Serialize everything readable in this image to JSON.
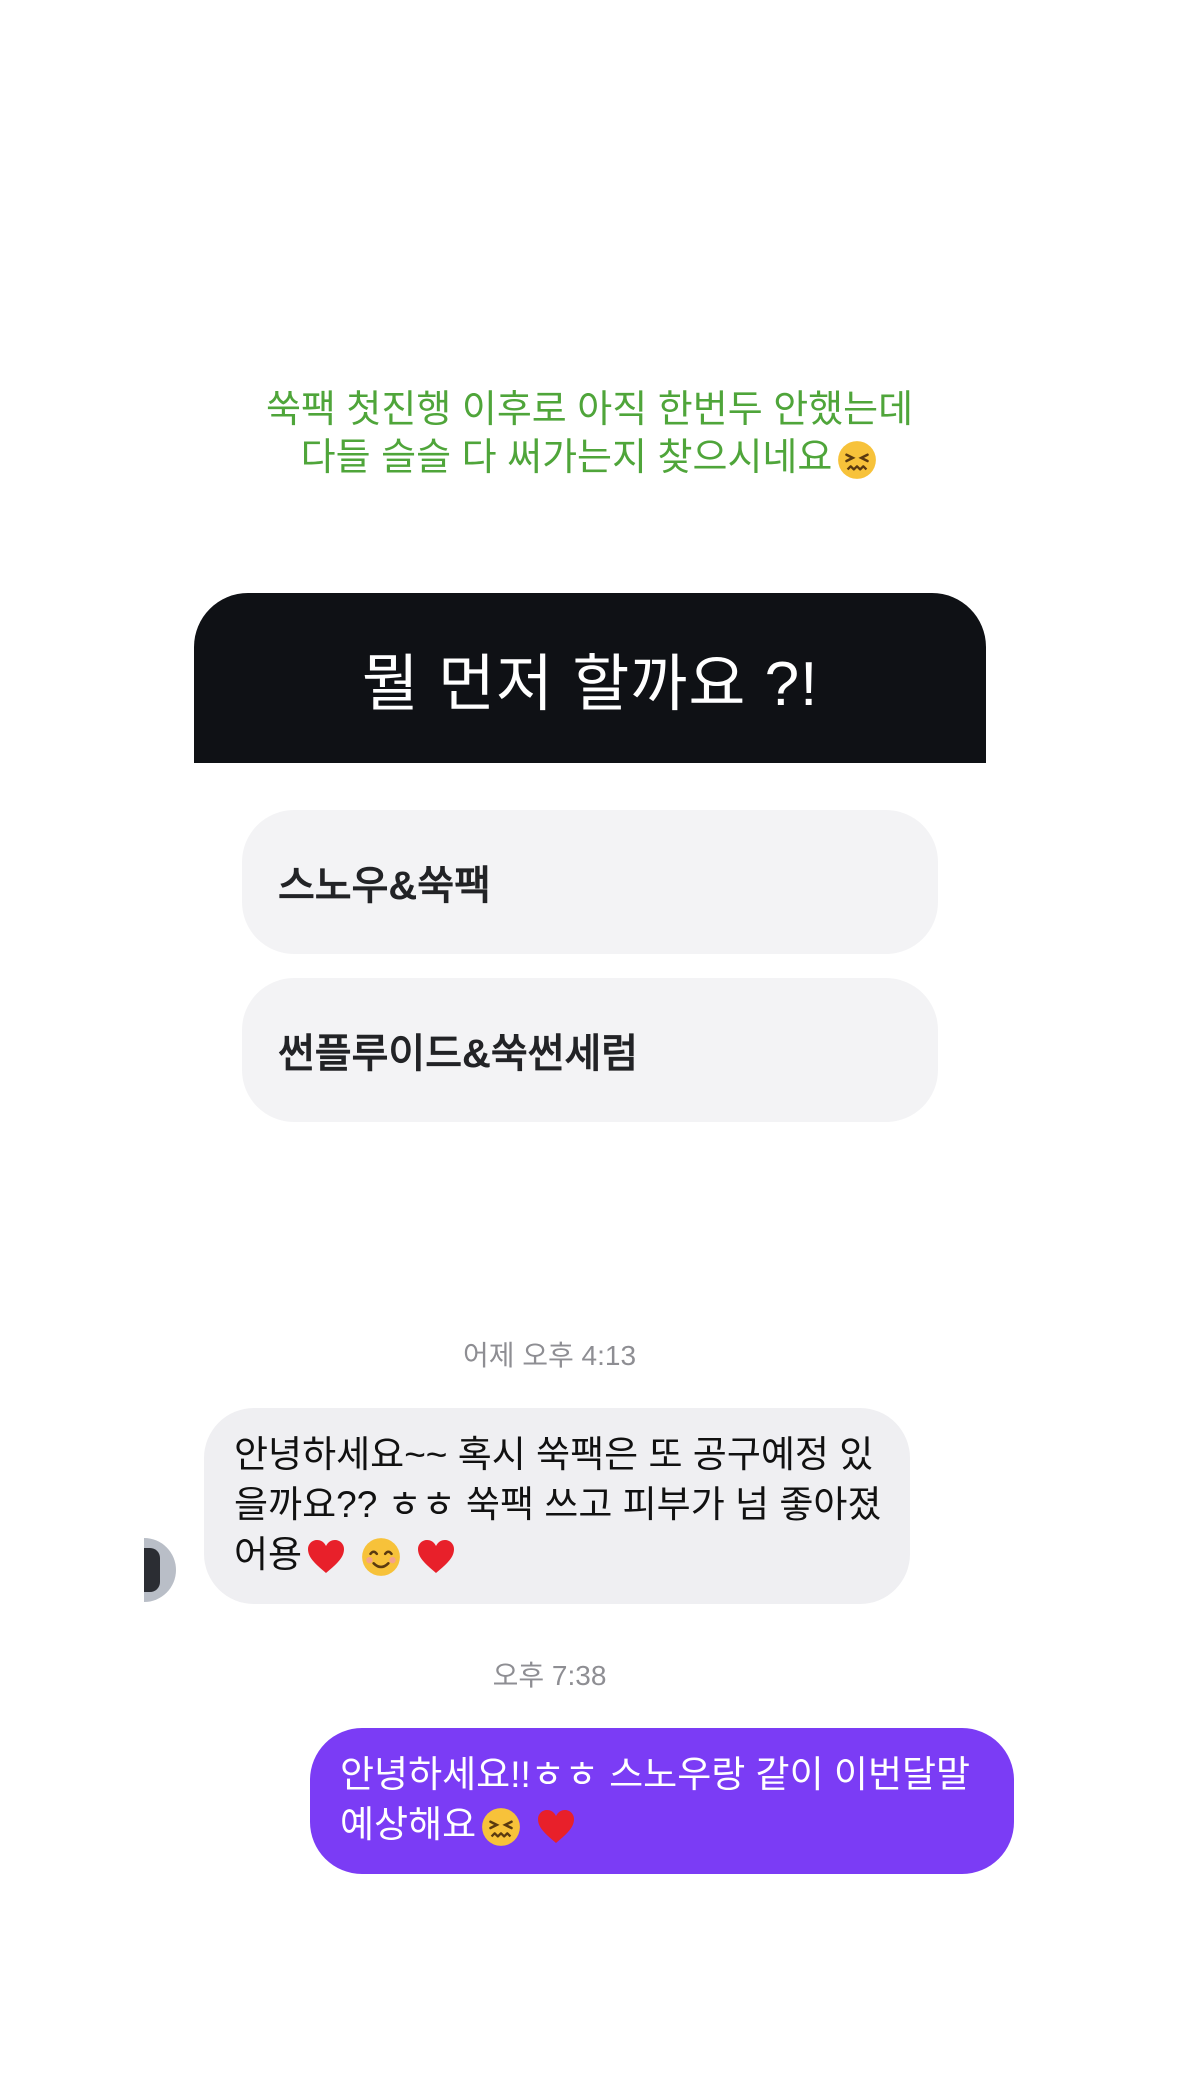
{
  "story": {
    "caption_lines": [
      "쑥팩 첫진행 이후로 아직 한번두 안했는데",
      "다들 슬슬 다 써가는지 찾으시네요"
    ],
    "caption_color": "#4fa53a",
    "caption_emoji": "confounded-face-icon"
  },
  "poll": {
    "question": "뭘 먼저 할까요 ?!",
    "options": [
      "스노우&쑥팩",
      "썬플루이드&쑥썬세럼"
    ]
  },
  "messages": [
    {
      "timestamp": "어제 오후 4:13",
      "direction": "incoming",
      "lines": [
        "안녕하세요~~ 혹시 쑥팩은 또 공구예정 있",
        "을까요?? ㅎㅎ 쑥팩 쓰고 피부가 넘 좋아졌",
        "어용"
      ],
      "emojis": [
        "heart-icon",
        "smiling-face-icon",
        "heart-icon"
      ]
    },
    {
      "timestamp": "오후 7:38",
      "direction": "outgoing",
      "lines": [
        "안녕하세요!!ㅎㅎ 스노우랑 같이 이번달말",
        "예상해요"
      ],
      "emojis": [
        "confounded-face-icon",
        "heart-icon"
      ]
    }
  ],
  "colors": {
    "outgoing_bubble": "#7b3cf5",
    "incoming_bubble": "#efeff2",
    "poll_header": "#0f1115"
  }
}
